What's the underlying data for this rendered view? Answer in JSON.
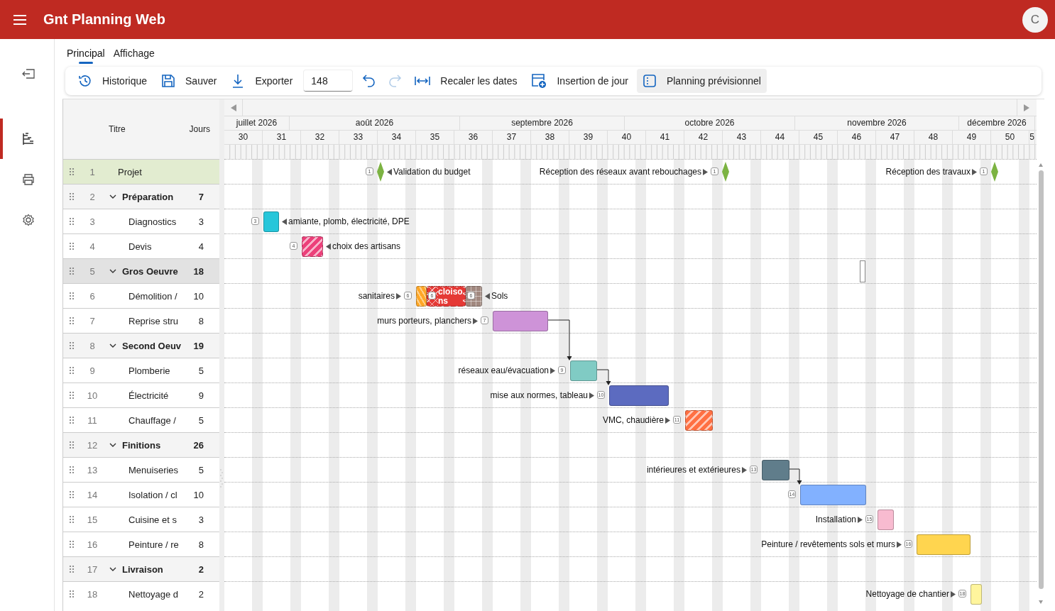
{
  "app": {
    "title": "Gnt Planning Web",
    "avatar": "C"
  },
  "nav_rail": [
    {
      "kind": "collapse",
      "selected": false
    },
    {
      "kind": "gantt",
      "selected": true
    },
    {
      "kind": "print",
      "selected": false
    },
    {
      "kind": "settings",
      "selected": false
    }
  ],
  "tabs": [
    {
      "label": "Principal",
      "selected": true
    },
    {
      "label": "Affichage",
      "selected": false
    }
  ],
  "toolbar": [
    {
      "kind": "history",
      "label": "Historique",
      "active": false
    },
    {
      "kind": "save",
      "label": "Sauver",
      "active": false
    },
    {
      "kind": "export",
      "label": "Exporter",
      "active": false
    },
    {
      "kind": "input",
      "value": "148"
    },
    {
      "kind": "undo",
      "disabled": false
    },
    {
      "kind": "redo",
      "disabled": true
    },
    {
      "kind": "fit",
      "label": "Recaler les dates",
      "active": false
    },
    {
      "kind": "insert-day",
      "label": "Insertion de jour",
      "active": false
    },
    {
      "kind": "planning",
      "label": "Planning prévisionnel",
      "active": true
    }
  ],
  "grid": {
    "columns": [
      "Titre",
      "Jours"
    ],
    "rows": [
      {
        "kind": "project",
        "number": "1",
        "title": "Projet",
        "selected": false,
        "timeline": [
          {
            "kind": "milestone",
            "number": "1",
            "color": "#7cb342",
            "label": "Validation du budget",
            "label_left": false
          },
          {
            "kind": "milestone",
            "number": "1",
            "color": "#7cb342",
            "label": "Réception des réseaux avant rebouchages",
            "label_left": true
          },
          {
            "kind": "milestone",
            "number": "1",
            "color": "#7cb342",
            "label": "Réception des travaux",
            "label_left": true
          }
        ]
      },
      {
        "kind": "group",
        "number": "2",
        "title": "Préparation",
        "days": "7",
        "expanded": true,
        "selected": false,
        "timeline": [],
        "children": [
          {
            "kind": "task",
            "number": "3",
            "title": "Diagnostics",
            "days": "3",
            "selected": false,
            "timeline": [
              {
                "kind": "bar",
                "number": "3",
                "color": "#26c6da",
                "label": "amiante, plomb, électricité, DPE",
                "label_left": false
              }
            ]
          },
          {
            "kind": "task",
            "number": "4",
            "title": "Devis",
            "days": "4",
            "selected": false,
            "timeline": [
              {
                "kind": "striped-bar",
                "number": "4",
                "color": "#ec407a",
                "label": "choix des artisans",
                "label_left": false
              }
            ]
          }
        ]
      },
      {
        "kind": "group",
        "number": "5",
        "title": "Gros Oeuvre",
        "days": "18",
        "expanded": true,
        "selected": true,
        "timeline": [
          {
            "kind": "outline"
          }
        ],
        "children": [
          {
            "kind": "task",
            "number": "6",
            "title": "Démolition /",
            "days": "10",
            "selected": false,
            "timeline": [
              {
                "kind": "zigzag-bar",
                "number": "6",
                "color": "#ffa726",
                "label": "sanitaires",
                "label_left": true
              },
              {
                "kind": "checked-bar",
                "number": "6",
                "color": "#e53935",
                "text": "cloisons"
              },
              {
                "kind": "grid-bar",
                "number": "6",
                "color": "#a1887f",
                "label": "Sols",
                "label_left": false
              }
            ]
          },
          {
            "kind": "task",
            "number": "7",
            "title": "Reprise stru",
            "days": "8",
            "selected": false,
            "timeline": [
              {
                "kind": "bar",
                "number": "7",
                "color": "#ce93d8",
                "label": "murs porteurs, planchers",
                "label_left": true,
                "link_to_next": true
              }
            ]
          }
        ]
      },
      {
        "kind": "group",
        "number": "8",
        "title": "Second Oeuv",
        "days": "19",
        "expanded": true,
        "selected": false,
        "timeline": [],
        "children": [
          {
            "kind": "task",
            "number": "9",
            "title": "Plomberie",
            "days": "5",
            "selected": false,
            "timeline": [
              {
                "kind": "bar",
                "number": "9",
                "color": "#80cbc4",
                "label": "réseaux eau/évacuation",
                "label_left": true,
                "link_to_next": true
              }
            ]
          },
          {
            "kind": "task",
            "number": "10",
            "title": "Électricité",
            "days": "9",
            "selected": false,
            "timeline": [
              {
                "kind": "bar",
                "number": "10",
                "color": "#5c6bc0",
                "label": "mise aux normes, tableau",
                "label_left": true
              }
            ]
          },
          {
            "kind": "task",
            "number": "11",
            "title": "Chauffage /",
            "days": "5",
            "selected": false,
            "timeline": [
              {
                "kind": "striped-bar",
                "number": "11",
                "color": "#ff7043",
                "label": "VMC, chaudière",
                "label_left": true
              }
            ]
          }
        ]
      },
      {
        "kind": "group",
        "number": "12",
        "title": "Finitions",
        "days": "26",
        "expanded": true,
        "selected": false,
        "timeline": [],
        "children": [
          {
            "kind": "task",
            "number": "13",
            "title": "Menuiseries",
            "days": "5",
            "selected": false,
            "timeline": [
              {
                "kind": "bar",
                "number": "13",
                "color": "#607d8b",
                "label": "intérieures et extérieures",
                "label_left": true,
                "link_to_next": true
              }
            ]
          },
          {
            "kind": "task",
            "number": "14",
            "title": "Isolation / cl",
            "days": "10",
            "selected": false,
            "timeline": [
              {
                "kind": "bar",
                "number": "14",
                "color": "#82b1ff"
              }
            ]
          },
          {
            "kind": "task",
            "number": "15",
            "title": "Cuisine et s",
            "days": "3",
            "selected": false,
            "timeline": [
              {
                "kind": "bar",
                "number": "15",
                "color": "#f8bbd0",
                "label": "Installation",
                "label_left": true
              }
            ]
          },
          {
            "kind": "task",
            "number": "16",
            "title": "Peinture / re",
            "days": "8",
            "selected": false,
            "timeline": [
              {
                "kind": "bar",
                "number": "16",
                "color": "#ffd54f",
                "label": "Peinture / revêtements sols et murs",
                "label_left": true
              }
            ]
          }
        ]
      },
      {
        "kind": "group",
        "number": "17",
        "title": "Livraison",
        "days": "2",
        "expanded": true,
        "selected": false,
        "timeline": [],
        "children": [
          {
            "kind": "task",
            "number": "18",
            "title": "Nettoyage d",
            "days": "2",
            "selected": false,
            "timeline": [
              {
                "kind": "bar",
                "number": "18",
                "color": "#fff59d",
                "label": "Nettoyage de chantier",
                "label_left": true
              }
            ]
          }
        ]
      }
    ]
  },
  "timeline": {
    "months": [
      "juillet 2026",
      "août 2026",
      "septembre 2026",
      "octobre 2026",
      "novembre 2026",
      "décembre 2026"
    ],
    "weeks": [
      "30",
      "31",
      "32",
      "33",
      "34",
      "35",
      "36",
      "37",
      "38",
      "39",
      "40",
      "41",
      "42",
      "43",
      "44",
      "45",
      "46",
      "47",
      "48",
      "49",
      "50",
      "5"
    ]
  }
}
